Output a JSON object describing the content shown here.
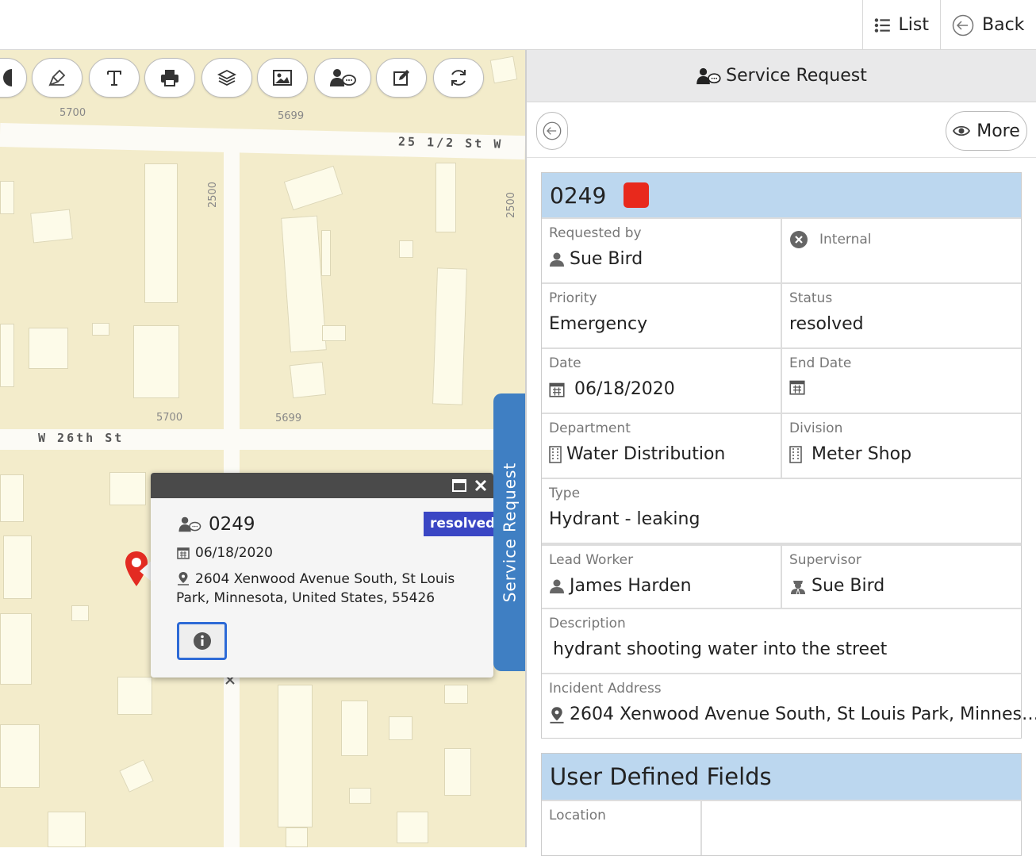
{
  "topbar": {
    "list_label": "List",
    "back_label": "Back"
  },
  "map": {
    "labels": {
      "addr_5700_top": "5700",
      "addr_5699_top": "5699",
      "addr_2500_left": "2500",
      "addr_2500_right": "2500",
      "addr_5700_mid": "5700",
      "addr_5699_mid": "5699"
    },
    "streets": {
      "top": "25 1/2 St W",
      "middle": "W 26th St"
    },
    "toolbar": [
      "circle-icon",
      "pen-icon",
      "text-icon",
      "print-icon",
      "layers-icon",
      "image-icon",
      "service-request-icon",
      "edit-icon",
      "refresh-icon"
    ]
  },
  "popup": {
    "id": "0249",
    "status_badge": "resolved",
    "date": "06/18/2020",
    "address": "2604 Xenwood Avenue South, St Louis Park, Minnesota, United States, 55426"
  },
  "side_tab": {
    "label": "Service Request"
  },
  "panel": {
    "title": "Service Request",
    "more_label": "More",
    "record": {
      "id": "0249",
      "status_color": "#e8291c",
      "requested_by_label": "Requested by",
      "requested_by": "Sue Bird",
      "internal_label": "Internal",
      "priority_label": "Priority",
      "priority": "Emergency",
      "status_label": "Status",
      "status": "resolved",
      "date_label": "Date",
      "date": "06/18/2020",
      "end_date_label": "End Date",
      "end_date": "",
      "department_label": "Department",
      "department": "Water Distribution",
      "division_label": "Division",
      "division": "Meter Shop",
      "type_label": "Type",
      "type": "Hydrant - leaking",
      "lead_worker_label": "Lead Worker",
      "lead_worker": "James Harden",
      "supervisor_label": "Supervisor",
      "supervisor": "Sue Bird",
      "description_label": "Description",
      "description": "hydrant shooting water into the street",
      "incident_address_label": "Incident Address",
      "incident_address": "2604 Xenwood Avenue South, St Louis Park, Minnes…"
    },
    "udf": {
      "title": "User Defined Fields",
      "location_label": "Location"
    }
  },
  "colors": {
    "accent": "#3f7fc3",
    "header_blue": "#bcd7ef",
    "badge": "#3a46c4",
    "status_red": "#e8291c"
  }
}
